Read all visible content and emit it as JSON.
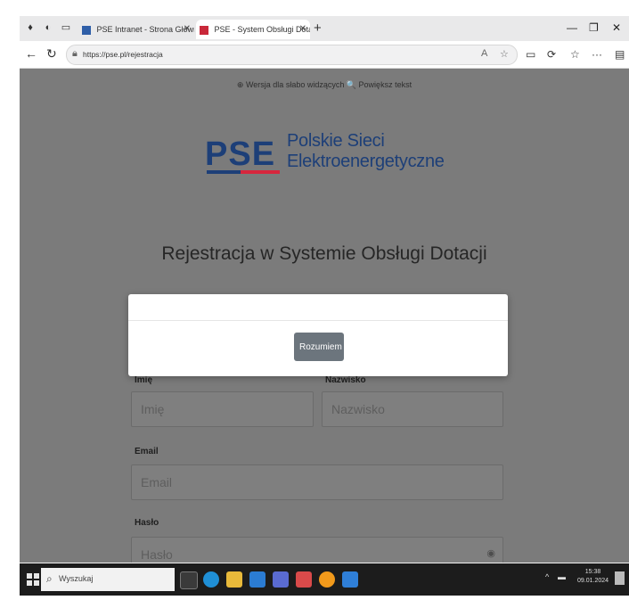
{
  "browser": {
    "tabs": [
      {
        "label": "PSE Intranet - Strona Główna",
        "active": false
      },
      {
        "label": "PSE - System Obsługi Dotacji - Z",
        "active": true
      }
    ],
    "new_tab_icon": "plus-icon",
    "window_controls": [
      "—",
      "❐",
      "✕"
    ],
    "url": "https://pse.pl/rejestracja"
  },
  "page": {
    "accessibility_text": "⊕ Wersja dla słabo widzących  🔍 Powiększ tekst",
    "logo": {
      "mark": "PSE",
      "line1": "Polskie Sieci",
      "line2": "Elektroenergetyczne"
    },
    "title": "Rejestracja w Systemie Obsługi Dotacji",
    "form": {
      "first_name_label": "Imię",
      "first_name_placeholder": "Imię",
      "last_name_label": "Nazwisko",
      "last_name_placeholder": "Nazwisko",
      "email_label": "Email",
      "email_placeholder": "Email",
      "password_label": "Hasło",
      "password_placeholder": "Hasło"
    }
  },
  "modal": {
    "button_label": "Rozumiem"
  },
  "taskbar": {
    "search_placeholder": "Wyszukaj",
    "time": "15:38",
    "date": "09.01.2024"
  },
  "colors": {
    "overlay": "#7b7b7b",
    "logo_blue": "#1d3f78",
    "logo_red": "#d7263d",
    "modal_button": "#6c757d"
  }
}
